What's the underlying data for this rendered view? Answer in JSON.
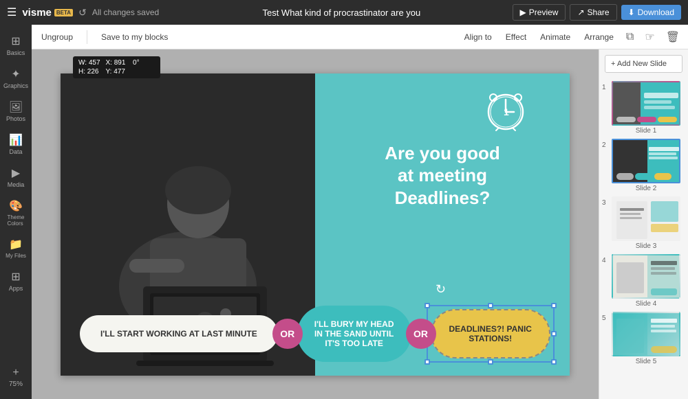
{
  "topbar": {
    "title": "Test What kind of procrastinator are you",
    "saved_text": "All changes saved",
    "preview_label": "Preview",
    "share_label": "Share",
    "download_label": "Download"
  },
  "sidebar": {
    "items": [
      {
        "label": "Basics",
        "icon": "⊞"
      },
      {
        "label": "Graphics",
        "icon": "★"
      },
      {
        "label": "Photos",
        "icon": "🖼"
      },
      {
        "label": "Data",
        "icon": "📊"
      },
      {
        "label": "Media",
        "icon": "▶"
      },
      {
        "label": "Theme Colors",
        "icon": "🎨"
      },
      {
        "label": "My Files",
        "icon": "📁"
      },
      {
        "label": "Apps",
        "icon": "⊞"
      }
    ],
    "zoom_add": "+",
    "zoom_level": "75%"
  },
  "toolbar": {
    "ungroup": "Ungroup",
    "save_to_blocks": "Save to my blocks",
    "align_to": "Align to",
    "effect": "Effect",
    "animate": "Animate",
    "arrange": "Arrange"
  },
  "transform": {
    "w_label": "W:",
    "w_value": "457",
    "x_label": "X:",
    "x_value": "891",
    "r_label": "0°",
    "h_label": "H:",
    "h_value": "226",
    "y_label": "Y:",
    "y_value": "477"
  },
  "canvas": {
    "headline_line1": "Are you good",
    "headline_line2": "at meeting",
    "headline_line3": "Deadlines?",
    "option1": "I'LL START WORKING AT\nLAST MINUTE",
    "option1_text": "I'LL START WORKING AT LAST MINUTE",
    "or1": "OR",
    "option2_line1": "I'LL BURY MY HEAD",
    "option2_line2": "IN THE SAND UNTIL",
    "option2_line3": "IT'S TOO LATE",
    "or2": "OR",
    "option3": "DEADLINES?! PANIC\nSTATIONS!",
    "option3_text": "DEADLINES?! PANIC STATIONS!"
  },
  "slides": {
    "add_label": "+ Add New Slide",
    "items": [
      {
        "number": "1",
        "label": "Slide 1"
      },
      {
        "number": "2",
        "label": "Slide 2"
      },
      {
        "number": "3",
        "label": "Slide 3"
      },
      {
        "number": "4",
        "label": "Slide 4"
      },
      {
        "number": "5",
        "label": "Slide 5"
      }
    ]
  },
  "colors": {
    "teal": "#5bc4c4",
    "pink": "#c44d8a",
    "yellow": "#e8c44a",
    "blue": "#4a90d9",
    "dark": "#2d2d2d"
  }
}
